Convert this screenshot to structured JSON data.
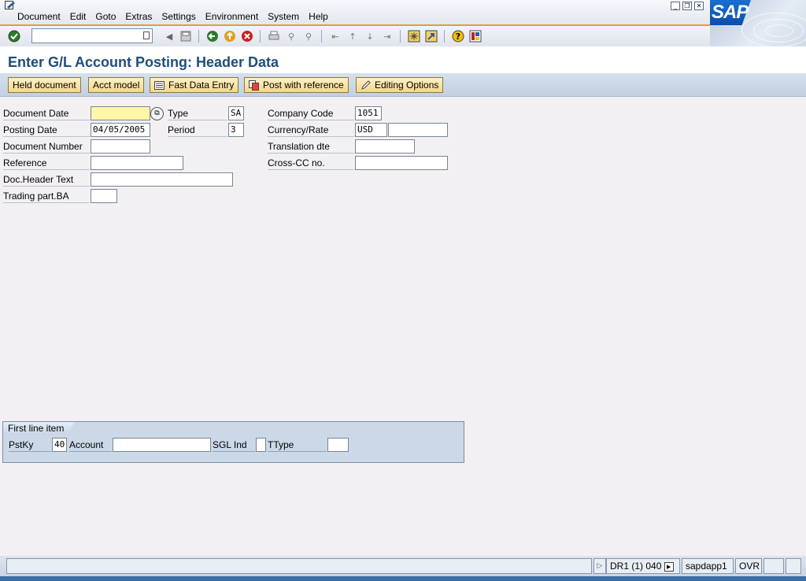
{
  "menu": {
    "items": [
      "Document",
      "Edit",
      "Goto",
      "Extras",
      "Settings",
      "Environment",
      "System",
      "Help"
    ]
  },
  "window_controls": [
    "minimize-icon",
    "restore-icon",
    "close-icon"
  ],
  "logo_text": "SAP",
  "toolbar": {
    "command_field_value": "",
    "icons": [
      "enter-icon",
      "back-icon",
      "exit-icon",
      "cancel-icon",
      "print-icon",
      "find-icon",
      "find-next-icon",
      "first-page-icon",
      "previous-page-icon",
      "next-page-icon",
      "last-page-icon",
      "create-session-icon",
      "shortcut-icon",
      "help-icon",
      "customize-layout-icon"
    ]
  },
  "title": "Enter G/L Account Posting: Header Data",
  "app_toolbar": {
    "held_document": "Held document",
    "acct_model": "Acct model",
    "fast_data_entry": "Fast Data Entry",
    "post_with_reference": "Post with reference",
    "editing_options": "Editing Options"
  },
  "form": {
    "document_date": {
      "label": "Document Date",
      "value": ""
    },
    "type": {
      "label": "Type",
      "value": "SA"
    },
    "company_code": {
      "label": "Company Code",
      "value": "1051"
    },
    "posting_date": {
      "label": "Posting Date",
      "value": "04/05/2005"
    },
    "period": {
      "label": "Period",
      "value": "3"
    },
    "currency_rate": {
      "label": "Currency/Rate",
      "currency": "USD",
      "rate": ""
    },
    "document_number": {
      "label": "Document Number",
      "value": ""
    },
    "translation_date": {
      "label": "Translation dte",
      "value": ""
    },
    "reference": {
      "label": "Reference",
      "value": ""
    },
    "cross_cc_no": {
      "label": "Cross-CC no.",
      "value": ""
    },
    "doc_header_text": {
      "label": "Doc.Header Text",
      "value": ""
    },
    "trading_part_ba": {
      "label": "Trading part.BA",
      "value": ""
    }
  },
  "first_line_item": {
    "title": "First line item",
    "pstky": {
      "label": "PstKy",
      "value": "40"
    },
    "account": {
      "label": "Account",
      "value": ""
    },
    "sgl_ind": {
      "label": "SGL Ind",
      "value": ""
    },
    "ttype": {
      "label": "TType",
      "value": ""
    }
  },
  "status_bar": {
    "system": "DR1 (1) 040",
    "server": "sapdapp1",
    "mode": "OVR"
  },
  "colors": {
    "title": "#1f4e79",
    "required_field": "#fff6a8",
    "button": "#f5d78a",
    "accent_line": "#e89a3c"
  }
}
